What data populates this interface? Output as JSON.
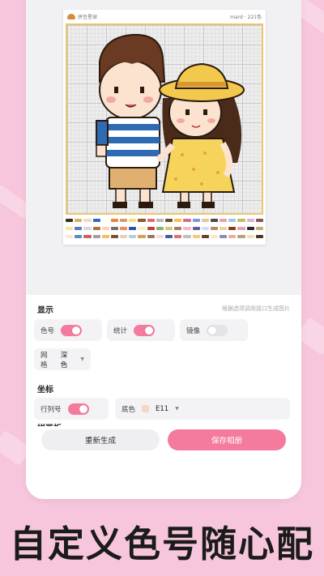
{
  "pattern": {
    "app_name": "拼豆星球",
    "meta": "mard · 221色",
    "legend_colors": [
      "#3a2a20",
      "#d9b35a",
      "#f3d7c8",
      "#2f6bb3",
      "#ffffff",
      "#e8873b",
      "#c9a26b",
      "#f2e07a",
      "#8a5a3a",
      "#e06b6b",
      "#b8b8b8",
      "#6a4a30",
      "#f6c24a",
      "#d07090",
      "#7a9bd0",
      "#eac49a",
      "#4a4a4a",
      "#f0a0a0",
      "#a0c8e8",
      "#c0c060",
      "#e0b0d0",
      "#905050",
      "#f7e6a0",
      "#5a7fb8",
      "#d8d8d8",
      "#b07040",
      "#ffd0b0",
      "#707070",
      "#e89060",
      "#3050a0",
      "#f9f0c0",
      "#c04040",
      "#90b070",
      "#e0c080",
      "#a08060",
      "#f4b8c8",
      "#606090",
      "#d0e0f0",
      "#b09060",
      "#f0d0a0",
      "#804020",
      "#e6a0b0",
      "#2a2a2a",
      "#c8a878",
      "#f8e8d8",
      "#5090c0",
      "#d06060",
      "#a0a0a0",
      "#f0c060",
      "#7a5030",
      "#e8d0c0",
      "#b0d0e0",
      "#d8a050",
      "#9a7a5a",
      "#f6d8e0",
      "#4060a0",
      "#e07070",
      "#c0c0c0",
      "#f8c878",
      "#6a4028",
      "#fbe8c8",
      "#8090c0",
      "#e8b0a0",
      "#b8a080",
      "#f0e0b0",
      "#503020"
    ]
  },
  "panel": {
    "display_title": "显示",
    "display_hint": "根据选项调用接口生成图片",
    "color_code_label": "色号",
    "color_code_on": true,
    "stats_label": "统计",
    "stats_on": true,
    "mirror_label": "镜像",
    "mirror_on": false,
    "grid_label": "网格",
    "grid_value": "深色",
    "coord_title": "坐标",
    "rowcol_label": "行列号",
    "rowcol_on": true,
    "base_label": "底色",
    "base_value": "E11",
    "base_color": "#f3d7c8",
    "cut_section_label": "拼豆板"
  },
  "actions": {
    "regenerate": "重新生成",
    "save_album": "保存相册"
  },
  "caption": "自定义色号随心配",
  "colors": {
    "accent": "#f47a9e",
    "background": "#f7c6dc"
  }
}
